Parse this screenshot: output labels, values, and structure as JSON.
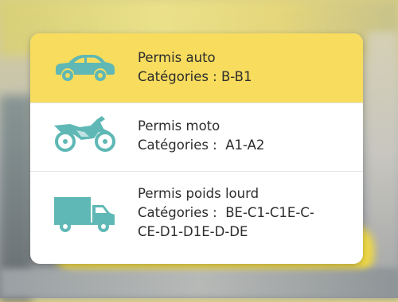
{
  "accent_color": "#f7dc5e",
  "icon_color": "#5fb8b5",
  "licenses": [
    {
      "icon": "car-icon",
      "title": "Permis auto",
      "categories_line": "Catégories : B-B1",
      "selected": true
    },
    {
      "icon": "motorcycle-icon",
      "title": "Permis moto",
      "categories_line": "Catégories :  A1-A2",
      "selected": false
    },
    {
      "icon": "truck-icon",
      "title": "Permis poids lourd",
      "categories_line": "Catégories :  BE-C1-C1E-C-",
      "categories_line2": "CE-D1-D1E-D-DE",
      "selected": false
    }
  ]
}
